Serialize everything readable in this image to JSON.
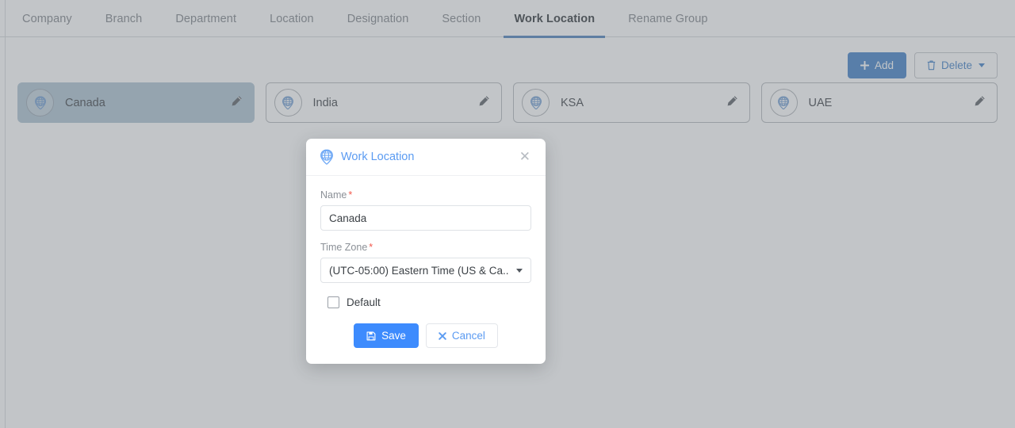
{
  "tabs": [
    {
      "label": "Company",
      "active": false
    },
    {
      "label": "Branch",
      "active": false
    },
    {
      "label": "Department",
      "active": false
    },
    {
      "label": "Location",
      "active": false
    },
    {
      "label": "Designation",
      "active": false
    },
    {
      "label": "Section",
      "active": false
    },
    {
      "label": "Work Location",
      "active": true
    },
    {
      "label": "Rename Group",
      "active": false
    }
  ],
  "toolbar": {
    "add_label": "Add",
    "add_icon": "plus-icon",
    "delete_label": "Delete",
    "delete_icon": "trash-icon",
    "delete_caret_icon": "chevron-down-icon"
  },
  "cards": [
    {
      "label": "Canada",
      "selected": true,
      "icon": "globe-pin-icon",
      "edit_icon": "pencil-icon"
    },
    {
      "label": "India",
      "selected": false,
      "icon": "globe-pin-icon",
      "edit_icon": "pencil-icon"
    },
    {
      "label": "KSA",
      "selected": false,
      "icon": "globe-pin-icon",
      "edit_icon": "pencil-icon"
    },
    {
      "label": "UAE",
      "selected": false,
      "icon": "globe-pin-icon",
      "edit_icon": "pencil-icon"
    }
  ],
  "modal": {
    "title": "Work Location",
    "title_icon": "globe-pin-icon",
    "close_icon": "close-icon",
    "name_label": "Name",
    "name_required": "*",
    "name_value": "Canada",
    "timezone_label": "Time Zone",
    "timezone_required": "*",
    "timezone_value": "(UTC-05:00) Eastern Time (US & Ca..",
    "timezone_caret_icon": "chevron-down-icon",
    "default_label": "Default",
    "default_checked": false,
    "save_label": "Save",
    "save_icon": "save-disk-icon",
    "cancel_label": "Cancel",
    "cancel_icon": "times-icon"
  },
  "colors": {
    "accent_blue": "#3d8bfd",
    "tab_active_underline": "#4a7ebb",
    "required_red": "#f2584c",
    "card_selected_bg": "#aec3d2",
    "backdrop": "#bfc3c7"
  }
}
